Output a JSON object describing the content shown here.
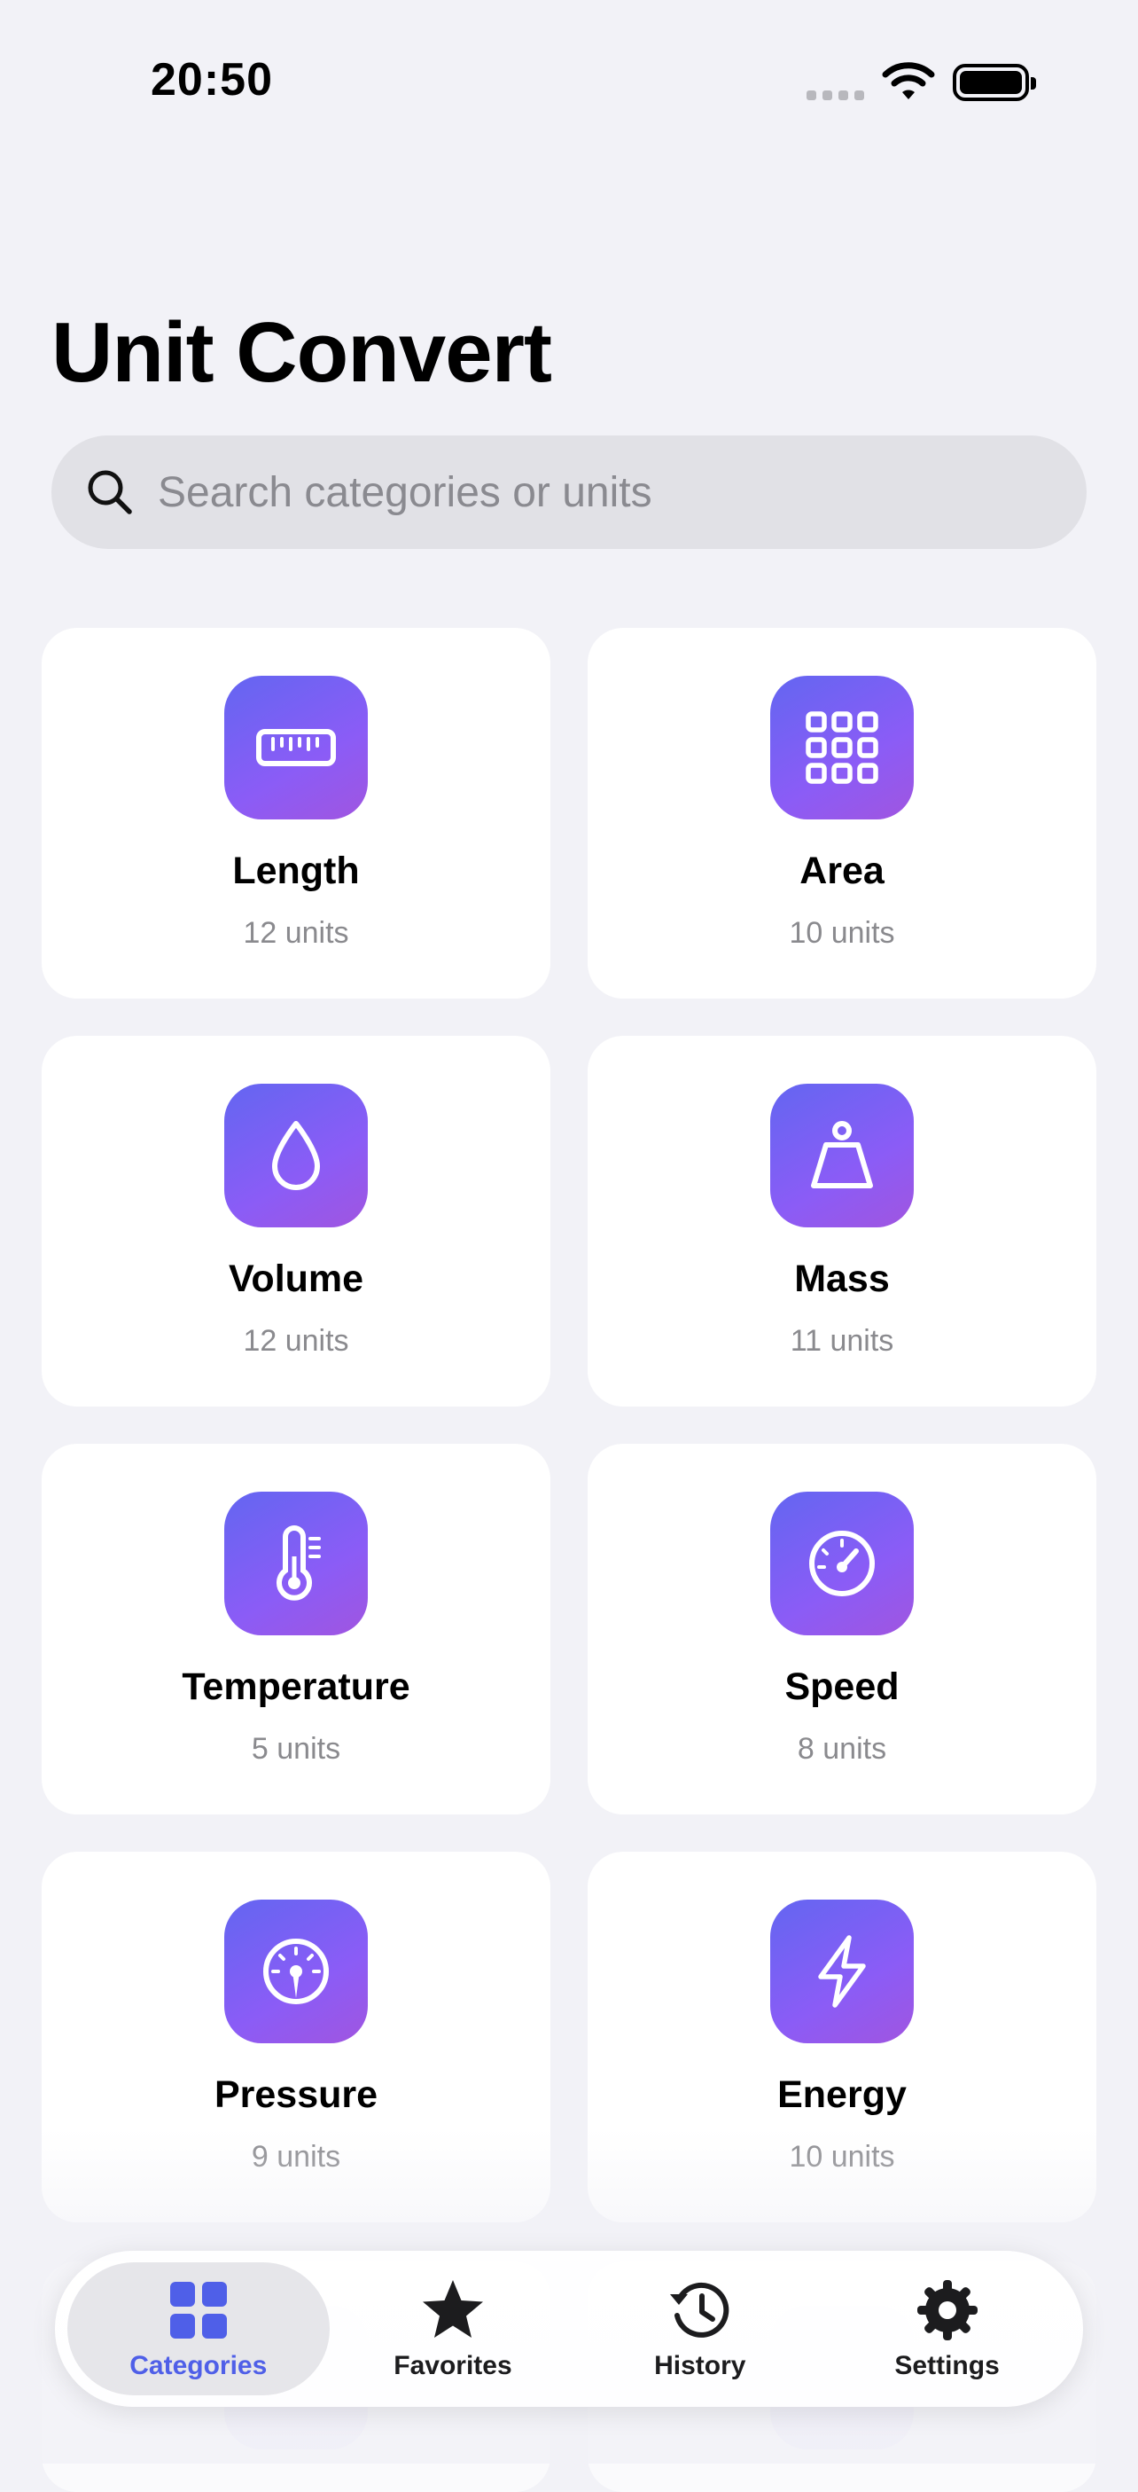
{
  "status_bar": {
    "time": "20:50"
  },
  "header": {
    "title": "Unit Convert"
  },
  "search": {
    "placeholder": "Search categories or units",
    "value": ""
  },
  "categories": [
    {
      "name": "Length",
      "count": "12 units",
      "icon": "ruler-icon"
    },
    {
      "name": "Area",
      "count": "10 units",
      "icon": "grid-icon"
    },
    {
      "name": "Volume",
      "count": "12 units",
      "icon": "drop-icon"
    },
    {
      "name": "Mass",
      "count": "11 units",
      "icon": "weight-icon"
    },
    {
      "name": "Temperature",
      "count": "5 units",
      "icon": "thermometer-icon"
    },
    {
      "name": "Speed",
      "count": "8 units",
      "icon": "speedometer-icon"
    },
    {
      "name": "Pressure",
      "count": "9 units",
      "icon": "gauge-icon"
    },
    {
      "name": "Energy",
      "count": "10 units",
      "icon": "bolt-icon"
    }
  ],
  "tab_bar": {
    "active": "Categories",
    "tabs": [
      {
        "label": "Categories",
        "icon": "grid-icon"
      },
      {
        "label": "Favorites",
        "icon": "star-icon"
      },
      {
        "label": "History",
        "icon": "history-icon"
      },
      {
        "label": "Settings",
        "icon": "gear-icon"
      }
    ]
  },
  "colors": {
    "accent": "#4f5fe8",
    "icon_gradient_start": "#6366f1",
    "icon_gradient_end": "#a055e0",
    "background": "#f2f2f7"
  }
}
